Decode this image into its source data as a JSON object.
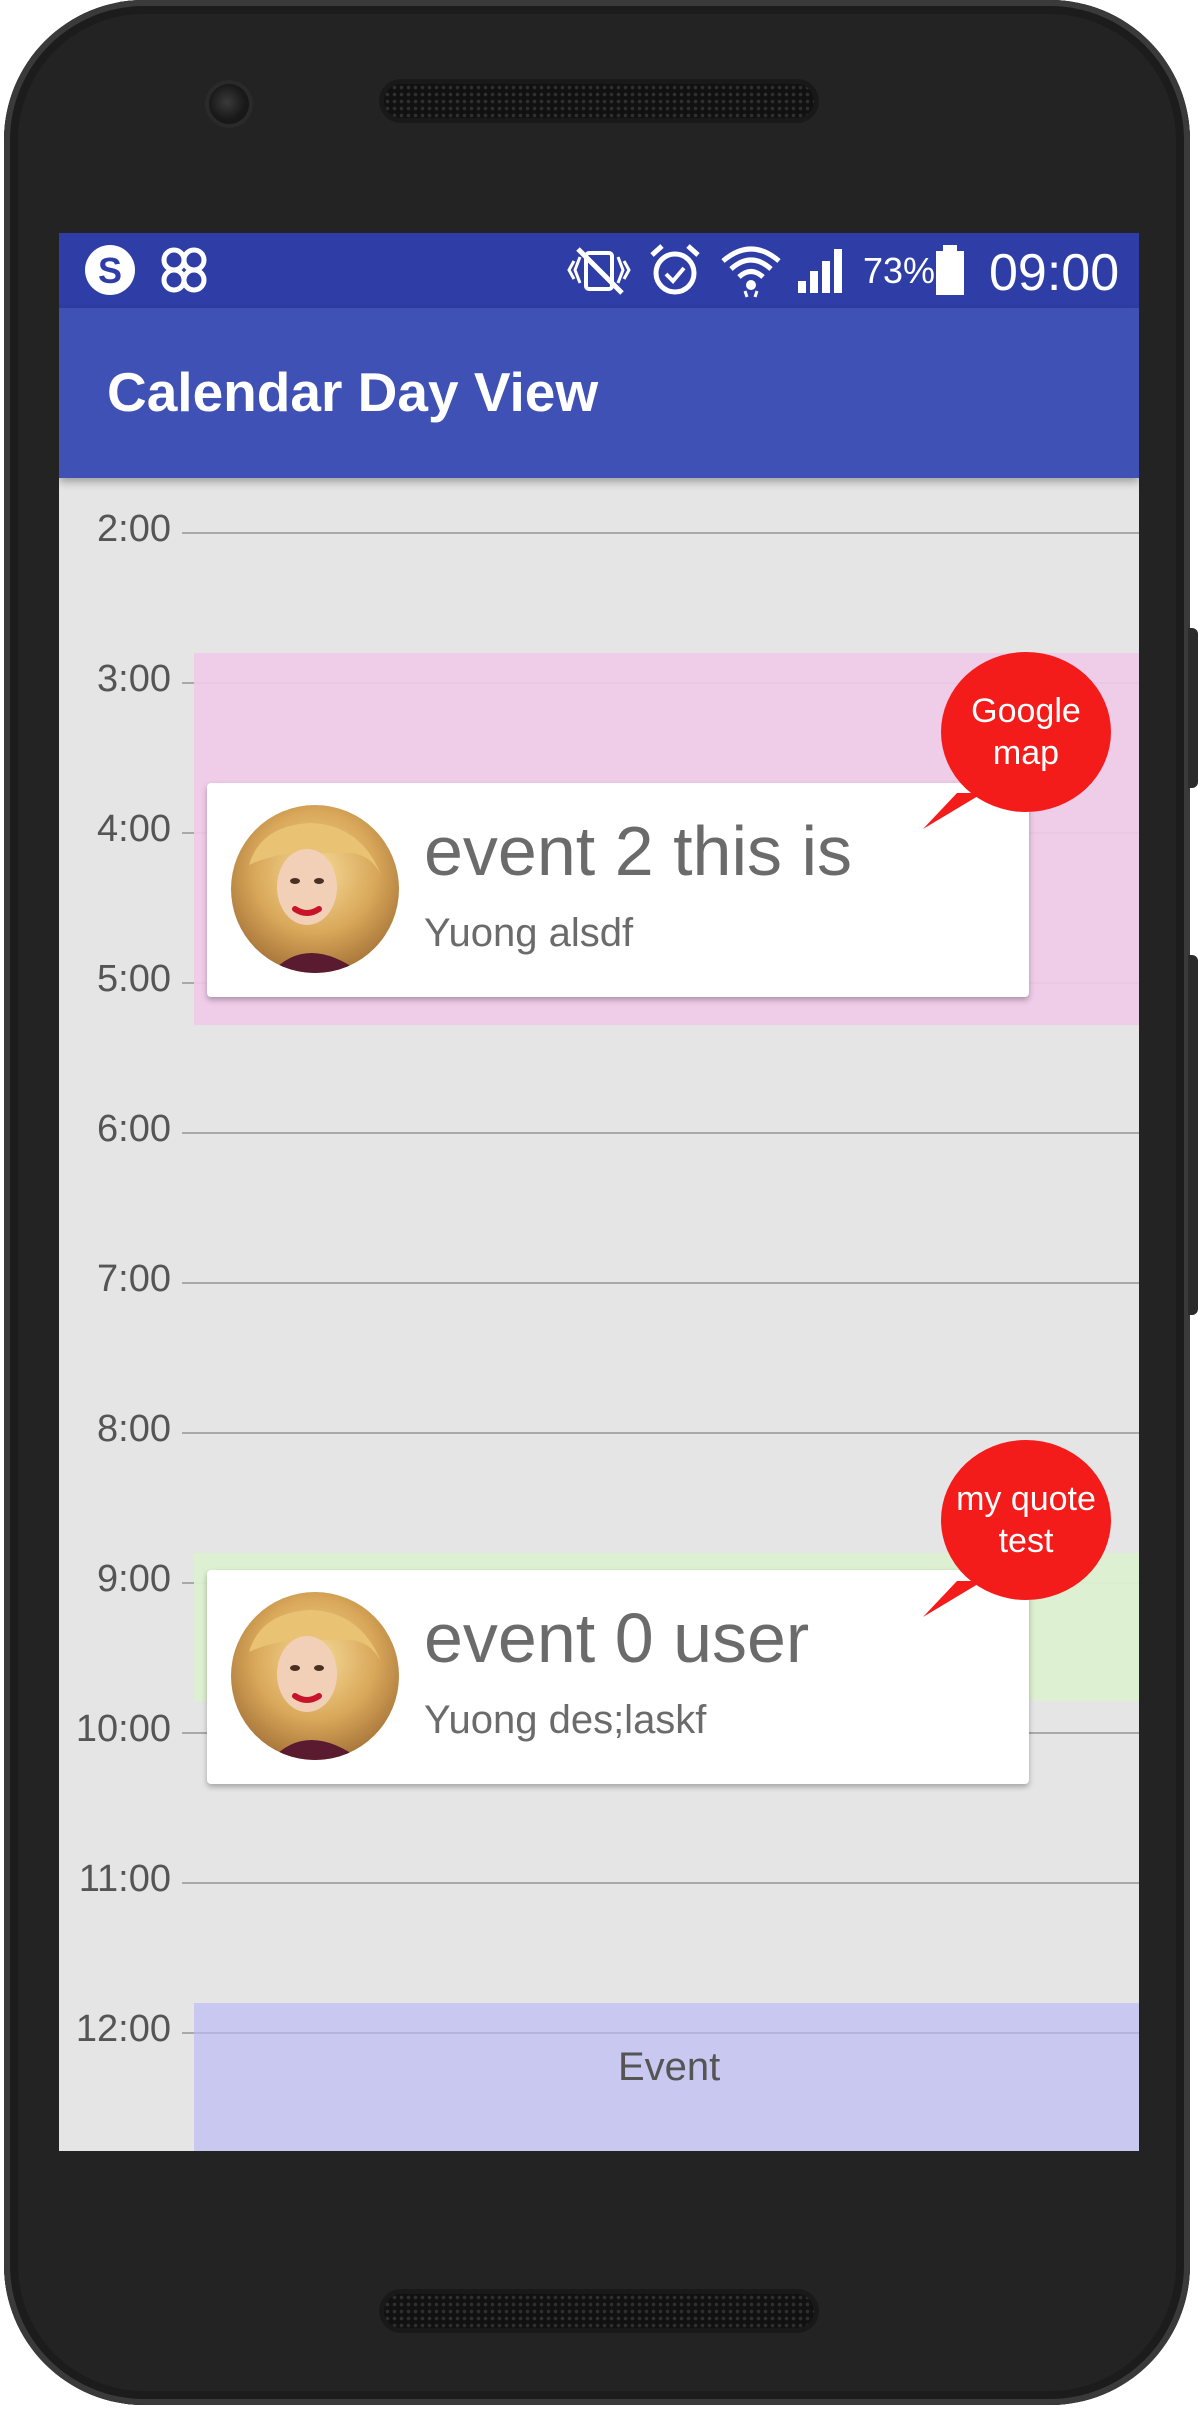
{
  "status_bar": {
    "battery_percent": "73%",
    "time": "09:00",
    "icons": [
      "skype-icon",
      "fan-icon",
      "vibrate-off-icon",
      "alarm-icon",
      "wifi-icon",
      "signal-icon",
      "battery-icon"
    ]
  },
  "app_bar": {
    "title": "Calendar Day View"
  },
  "timeline": {
    "hours": [
      "2:00",
      "3:00",
      "4:00",
      "5:00",
      "6:00",
      "7:00",
      "8:00",
      "9:00",
      "10:00",
      "11:00",
      "12:00"
    ]
  },
  "events": [
    {
      "title": "event 2 this is",
      "subtitle": "Yuong alsdf",
      "bubble": "Google map",
      "block_color": "#f0cae8"
    },
    {
      "title": "event 0 user",
      "subtitle": "Yuong des;laskf",
      "bubble": "my quote test",
      "block_color": "#dcf0d0"
    },
    {
      "title": "Event",
      "block_color": "#c8c8f0"
    }
  ],
  "colors": {
    "status_bar": "#2e3ea6",
    "app_bar": "#3f51b5",
    "bubble": "#f41b1b",
    "background": "#e5e5e5"
  }
}
